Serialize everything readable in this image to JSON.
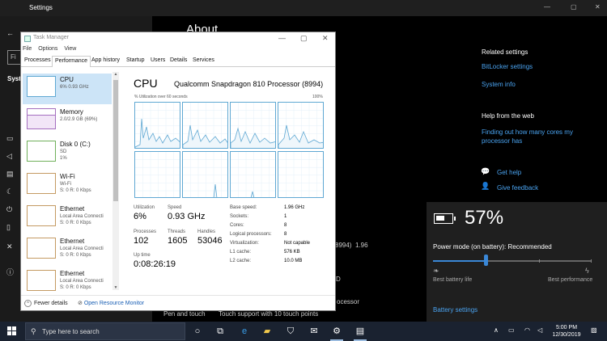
{
  "settings": {
    "title": "Settings",
    "heading": "About",
    "left_label": "Syst",
    "search_label": "Fi",
    "related_heading": "Related settings",
    "related_links": [
      "BitLocker settings",
      "System info"
    ],
    "help_heading": "Help from the web",
    "help_link": "Finding out how many cores my processor has",
    "get_help": "Get help",
    "give_feedback": "Give feedback",
    "behind_text": [
      "8994)",
      "1.96",
      "Pen and touch",
      "Touch support with 10 touch points",
      "ocessor",
      "D"
    ]
  },
  "battery": {
    "percent": "57%",
    "level": 0.57,
    "mode_label": "Power mode (on battery): Recommended",
    "slider_value": 0.33,
    "best_life": "Best battery life",
    "best_perf": "Best performance",
    "settings_link": "Battery settings"
  },
  "taskmanager": {
    "title": "Task Manager",
    "menu": [
      "File",
      "Options",
      "View"
    ],
    "tabs": [
      "Processes",
      "Performance",
      "App history",
      "Startup",
      "Users",
      "Details",
      "Services"
    ],
    "active_tab": "Performance",
    "resources": [
      {
        "name": "CPU",
        "sub": "6%  0.93 GHz",
        "sub2": "",
        "kind": "cpu"
      },
      {
        "name": "Memory",
        "sub": "2.0/2.9 GB (69%)",
        "sub2": "",
        "kind": "mem"
      },
      {
        "name": "Disk 0 (C:)",
        "sub": "SD",
        "sub2": "1%",
        "kind": "dsk"
      },
      {
        "name": "Wi-Fi",
        "sub": "Wi-Fi",
        "sub2": "S: 0  R: 0 Kbps",
        "kind": "net"
      },
      {
        "name": "Ethernet",
        "sub": "Local Area Connecti",
        "sub2": "S: 0  R: 0 Kbps",
        "kind": "net"
      },
      {
        "name": "Ethernet",
        "sub": "Local Area Connecti",
        "sub2": "S: 0  R: 0 Kbps",
        "kind": "net"
      },
      {
        "name": "Ethernet",
        "sub": "Local Area Connecti",
        "sub2": "S: 0  R: 0 Kbps",
        "kind": "net"
      }
    ],
    "cpu": {
      "heading": "CPU",
      "processor": "Qualcomm Snapdragon 810 Processor (8994)",
      "util_label": "% Utilization over 60 seconds",
      "util_max": "100%",
      "stats": {
        "utilization_label": "Utilization",
        "utilization": "6%",
        "speed_label": "Speed",
        "speed": "0.93 GHz",
        "processes_label": "Processes",
        "processes": "102",
        "threads_label": "Threads",
        "threads": "1605",
        "handles_label": "Handles",
        "handles": "53046",
        "uptime_label": "Up time",
        "uptime": "0:08:26:19"
      },
      "specs": [
        {
          "label": "Base speed:",
          "value": "1.96 GHz"
        },
        {
          "label": "Sockets:",
          "value": "1"
        },
        {
          "label": "Cores:",
          "value": "8"
        },
        {
          "label": "Logical processors:",
          "value": "8"
        },
        {
          "label": "Virtualization:",
          "value": "Not capable"
        },
        {
          "label": "L1 cache:",
          "value": "576 KB"
        },
        {
          "label": "L2 cache:",
          "value": "10.0 MB"
        }
      ]
    },
    "fewer_details": "Fewer details",
    "open_monitor": "Open Resource Monitor"
  },
  "taskbar": {
    "search_placeholder": "Type here to search",
    "time": "5:00 PM",
    "date": "12/30/2019"
  }
}
